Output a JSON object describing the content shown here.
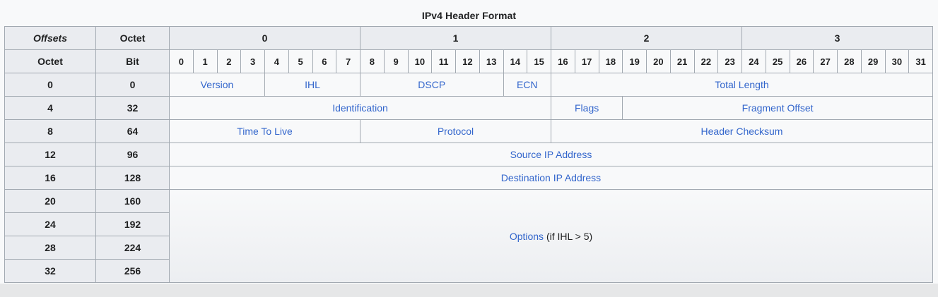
{
  "title": "IPv4 Header Format",
  "header": {
    "offsets_label": "Offsets",
    "octet_label": "Octet",
    "octet_row_label": "Octet",
    "bit_label": "Bit",
    "octets": [
      "0",
      "1",
      "2",
      "3"
    ],
    "bits": [
      "0",
      "1",
      "2",
      "3",
      "4",
      "5",
      "6",
      "7",
      "8",
      "9",
      "10",
      "11",
      "12",
      "13",
      "14",
      "15",
      "16",
      "17",
      "18",
      "19",
      "20",
      "21",
      "22",
      "23",
      "24",
      "25",
      "26",
      "27",
      "28",
      "29",
      "30",
      "31"
    ]
  },
  "rows": [
    {
      "octet": "0",
      "bit": "0"
    },
    {
      "octet": "4",
      "bit": "32"
    },
    {
      "octet": "8",
      "bit": "64"
    },
    {
      "octet": "12",
      "bit": "96"
    },
    {
      "octet": "16",
      "bit": "128"
    },
    {
      "octet": "20",
      "bit": "160"
    },
    {
      "octet": "24",
      "bit": "192"
    },
    {
      "octet": "28",
      "bit": "224"
    },
    {
      "octet": "32",
      "bit": "256"
    }
  ],
  "fields": {
    "version": "Version",
    "ihl": "IHL",
    "dscp": "DSCP",
    "ecn": "ECN",
    "total_length": "Total Length",
    "identification": "Identification",
    "flags": "Flags",
    "fragment_offset": "Fragment Offset",
    "ttl": "Time To Live",
    "protocol": "Protocol",
    "header_checksum": "Header Checksum",
    "source_ip": "Source IP Address",
    "destination_ip": "Destination IP Address",
    "options": "Options",
    "options_note": " (if IHL > 5)"
  },
  "colors": {
    "link": "#3366cc",
    "header_bg": "#eaecf0",
    "border": "#a2a9b1"
  }
}
